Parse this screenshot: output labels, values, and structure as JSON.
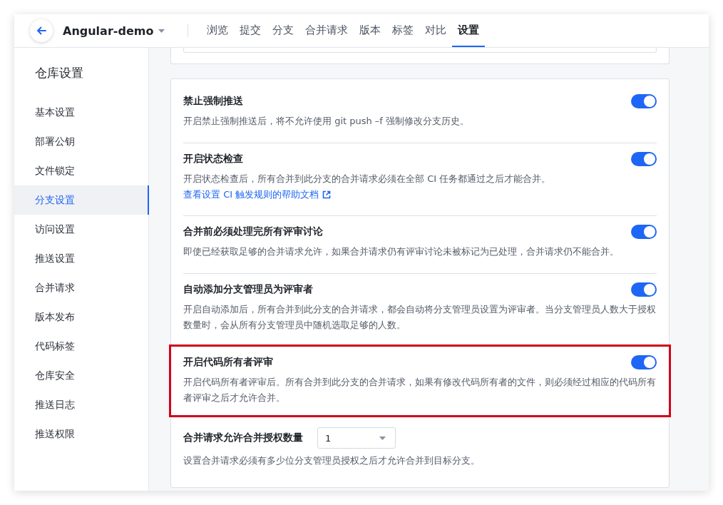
{
  "header": {
    "repo": "Angular-demo",
    "tabs": [
      {
        "label": "浏览",
        "selected": false
      },
      {
        "label": "提交",
        "selected": false
      },
      {
        "label": "分支",
        "selected": false
      },
      {
        "label": "合并请求",
        "selected": false
      },
      {
        "label": "版本",
        "selected": false
      },
      {
        "label": "标签",
        "selected": false
      },
      {
        "label": "对比",
        "selected": false
      },
      {
        "label": "设置",
        "selected": true
      }
    ]
  },
  "sidebar": {
    "title": "仓库设置",
    "items": [
      {
        "label": "基本设置",
        "selected": false
      },
      {
        "label": "部署公钥",
        "selected": false
      },
      {
        "label": "文件锁定",
        "selected": false
      },
      {
        "label": "分支设置",
        "selected": true
      },
      {
        "label": "访问设置",
        "selected": false
      },
      {
        "label": "推送设置",
        "selected": false
      },
      {
        "label": "合并请求",
        "selected": false
      },
      {
        "label": "版本发布",
        "selected": false
      },
      {
        "label": "代码标签",
        "selected": false
      },
      {
        "label": "仓库安全",
        "selected": false
      },
      {
        "label": "推送日志",
        "selected": false
      },
      {
        "label": "推送权限",
        "selected": false
      }
    ]
  },
  "settings": [
    {
      "kind": "toggle",
      "title": "禁止强制推送",
      "on": true,
      "highlighted": false,
      "description": "开启禁止强制推送后，将不允许使用 git push –f 强制修改分支历史。"
    },
    {
      "kind": "toggle",
      "title": "开启状态检查",
      "on": true,
      "highlighted": false,
      "description": "开启状态检查后，所有合并到此分支的合并请求必须在全部 CI 任务都通过之后才能合并。",
      "link": "查看设置 CI 触发规则的帮助文档"
    },
    {
      "kind": "toggle",
      "title": "合并前必须处理完所有评审讨论",
      "on": true,
      "highlighted": false,
      "description": "即使已经获取足够的合并请求允许，如果合并请求仍有评审讨论未被标记为已处理，合并请求仍不能合并。"
    },
    {
      "kind": "toggle",
      "title": "自动添加分支管理员为评审者",
      "on": true,
      "highlighted": false,
      "description": "开启自动添加后，所有合并到此分支的合并请求，都会自动将分支管理员设置为评审者。当分支管理员人数大于授权数量时，会从所有分支管理员中随机选取足够的人数。"
    },
    {
      "kind": "toggle",
      "title": "开启代码所有者评审",
      "on": true,
      "highlighted": true,
      "description": "开启代码所有者评审后。所有合并到此分支的合并请求，如果有修改代码所有者的文件，则必须经过相应的代码所有者评审之后才允许合并。"
    },
    {
      "kind": "select",
      "title": "合并请求允许合并授权数量",
      "value": "1",
      "highlighted": false,
      "description": "设置合并请求必须有多少位分支管理员授权之后才允许合并到目标分支。"
    }
  ]
}
